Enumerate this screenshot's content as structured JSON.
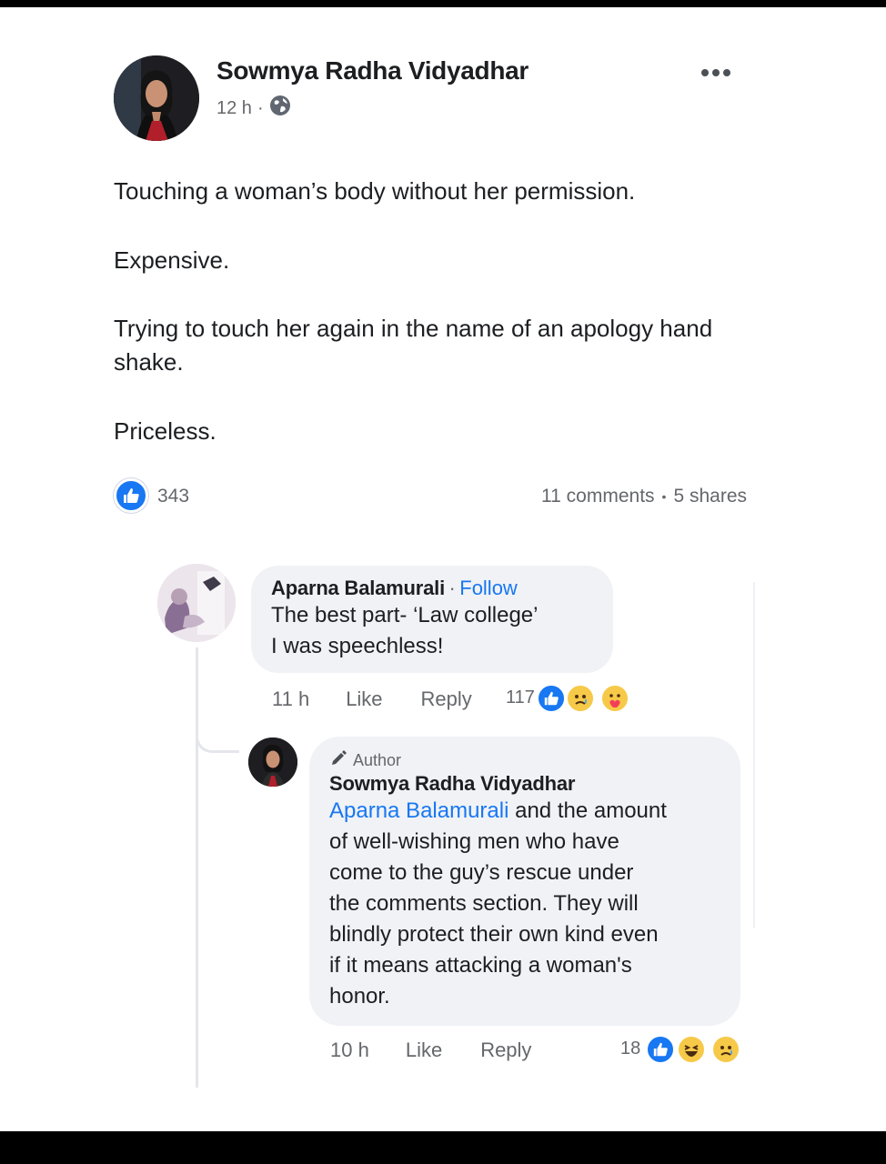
{
  "post": {
    "author": "Sowmya Radha Vidyadhar",
    "time": "12 h",
    "separator": "·",
    "privacy_icon": "globe-icon",
    "more_icon": "more-options-icon",
    "lines": [
      "Touching a woman’s body without her permission.",
      "Expensive.",
      "Trying to touch her again in the name of an apology hand shake.",
      "Priceless."
    ],
    "reactions": {
      "icon": "like-icon",
      "count": "343"
    },
    "comments_count": "11 comments",
    "bullet": "•",
    "shares_count": "5 shares"
  },
  "comments": [
    {
      "author": "Aparna Balamurali",
      "separator": "·",
      "follow_label": "Follow",
      "text_lines": [
        "The best part-  ‘Law college’",
        "I was speechless!"
      ],
      "time": "11 h",
      "like_label": "Like",
      "reply_label": "Reply",
      "reaction_count": "117",
      "reaction_icons": [
        "like-icon",
        "sad-icon",
        "care-icon"
      ]
    }
  ],
  "reply": {
    "badge_icon": "pen-icon",
    "badge_label": "Author",
    "author": "Sowmya Radha Vidyadhar",
    "mention": "Aparna Balamurali",
    "text_first": " and the amount",
    "text_lines": [
      "of well-wishing men who have",
      "come to the guy’s rescue under",
      "the comments section.  They will",
      "blindly protect their own kind even",
      "if it means attacking a woman's",
      "honor."
    ],
    "time": "10 h",
    "like_label": "Like",
    "reply_label": "Reply",
    "reaction_count": "18",
    "reaction_icons": [
      "like-icon",
      "haha-icon",
      "sad-icon"
    ]
  },
  "colors": {
    "accent": "#1877f2",
    "text": "#1c1e21",
    "muted": "#65676b",
    "bubble": "#f0f2f5",
    "emoji_yellow": "#f7c948"
  }
}
